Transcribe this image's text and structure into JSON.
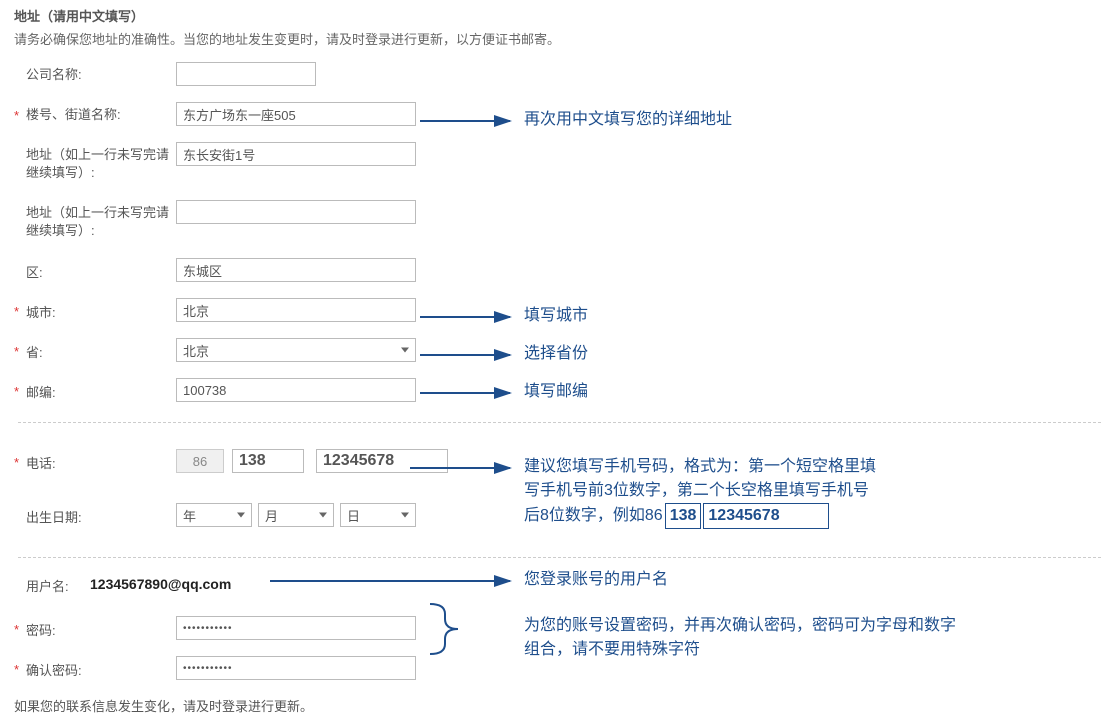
{
  "section": {
    "title": "地址（请用中文填写）",
    "desc": "请务必确保您地址的准确性。当您的地址发生变更时，请及时登录进行更新，以方便证书邮寄。"
  },
  "fields": {
    "company": {
      "label": "公司名称:",
      "value": ""
    },
    "street": {
      "label": "楼号、街道名称:",
      "value": "东方广场东一座505"
    },
    "addr2": {
      "label": "地址（如上一行未写完请继续填写）:",
      "value": "东长安街1号"
    },
    "addr3": {
      "label": "地址（如上一行未写完请继续填写）:",
      "value": ""
    },
    "district": {
      "label": "区:",
      "value": "东城区"
    },
    "city": {
      "label": "城市:",
      "value": "北京"
    },
    "province": {
      "label": "省:",
      "value": "北京"
    },
    "postcode": {
      "label": "邮编:",
      "value": "100738"
    },
    "phone": {
      "label": "电话:",
      "country": "86",
      "prefix": "138",
      "number": "12345678"
    },
    "birthdate": {
      "label": "出生日期:",
      "year": "年",
      "month": "月",
      "day": "日"
    },
    "username": {
      "label": "用户名:",
      "value": "1234567890@qq.com"
    },
    "password": {
      "label": "密码:",
      "value": "•••••••••••"
    },
    "confirm": {
      "label": "确认密码:",
      "value": "•••••••••••"
    }
  },
  "footer": "如果您的联系信息发生变化，请及时登录进行更新。",
  "annotations": {
    "street": "再次用中文填写您的详细地址",
    "city": "填写城市",
    "province": "选择省份",
    "postcode": "填写邮编",
    "phone1": "建议您填写手机号码，格式为：第一个短空格里填",
    "phone2": "写手机号前3位数字，第二个长空格里填写手机号",
    "phone3a": "后8位数字，例如86",
    "phone3b": "138",
    "phone3c": "12345678",
    "username": "您登录账号的用户名",
    "password": "为您的账号设置密码，并再次确认密码，密码可为字母和数字组合，请不要用特殊字符"
  }
}
